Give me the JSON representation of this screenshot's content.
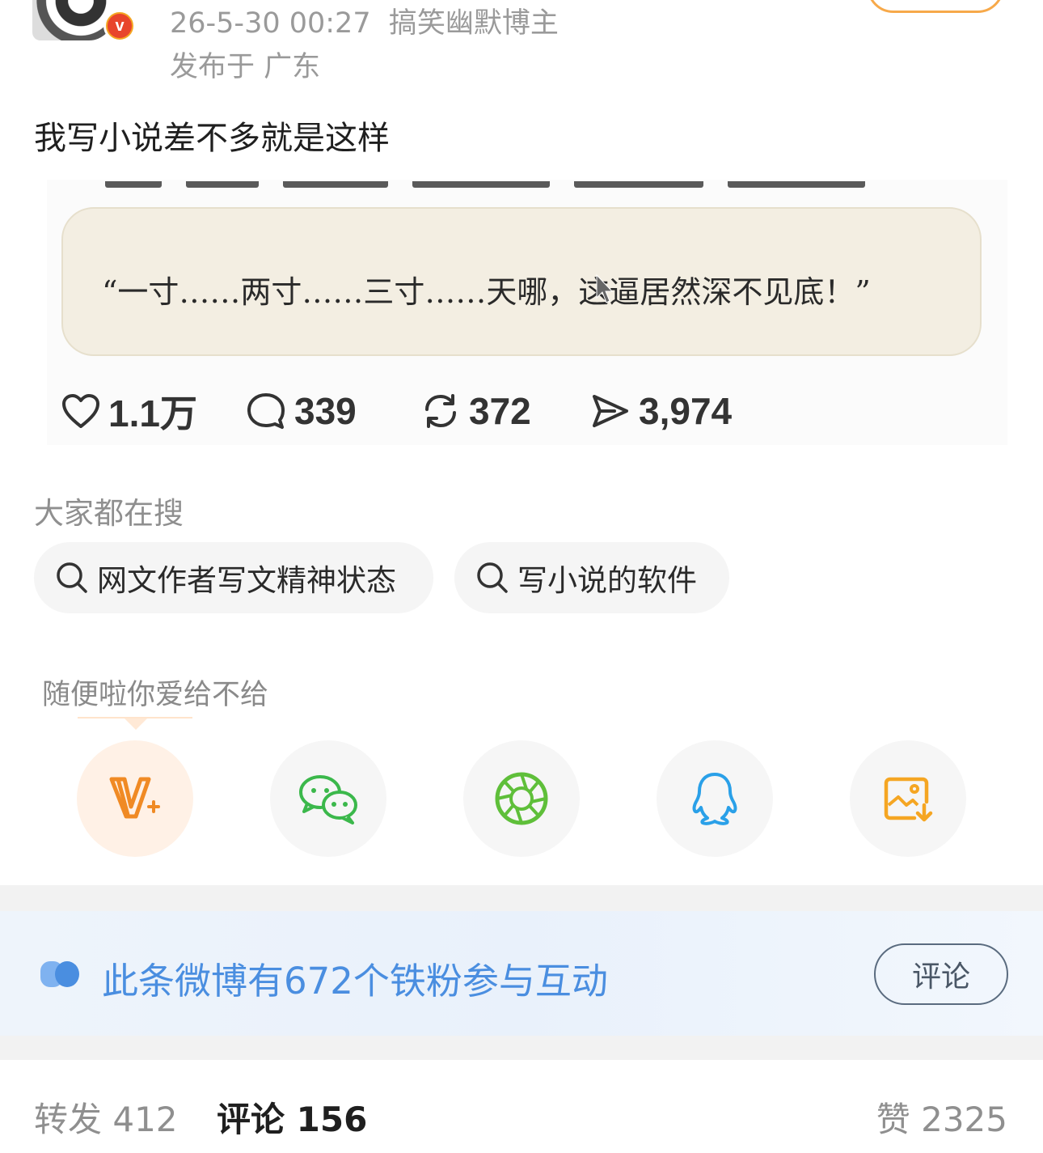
{
  "post": {
    "meta": {
      "time": "26-5-30 00:27",
      "author_tag": "搞笑幽默博主",
      "location": "发布于 广东"
    },
    "text": "我写小说差不多就是这样",
    "image": {
      "quote": "“一寸……两寸……三寸……天哪，这逼居然深不见底！”"
    },
    "stats": {
      "likes": "1.1万",
      "comments": "339",
      "reposts": "372",
      "shares": "3,974"
    }
  },
  "search": {
    "title": "大家都在搜",
    "chips": [
      "网文作者写文精神状态",
      "写小说的软件"
    ]
  },
  "share": {
    "caption": "随便啦你爱给不给",
    "targets": [
      {
        "icon": "v-plus-icon",
        "color": "#f08a24"
      },
      {
        "icon": "wechat-icon",
        "color": "#3bb84b"
      },
      {
        "icon": "moments-icon",
        "color": "#5fbf3a"
      },
      {
        "icon": "qq-icon",
        "color": "#2aa0e8"
      },
      {
        "icon": "save-image-icon",
        "color": "#f5a623"
      }
    ]
  },
  "fans": {
    "text": "此条微博有672个铁粉参与互动",
    "button": "评论"
  },
  "tabs": {
    "repost": "转发 412",
    "comment": "评论 156",
    "like": "赞 2325"
  }
}
